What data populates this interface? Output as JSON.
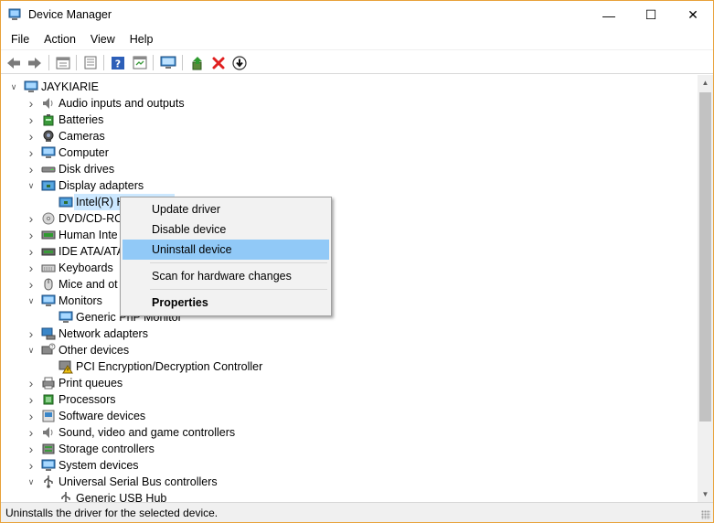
{
  "window": {
    "title": "Device Manager",
    "minimize_glyph": "—",
    "maximize_glyph": "☐",
    "close_glyph": "✕"
  },
  "menu": [
    "File",
    "Action",
    "View",
    "Help"
  ],
  "toolbar": [
    "back-icon",
    "forward-icon",
    "properties-icon",
    "show-hidden-icon",
    "help-icon",
    "action-view-icon",
    "monitor-icon",
    "update-driver-icon",
    "uninstall-icon",
    "download-icon"
  ],
  "tree": {
    "root": "JAYKIARIE",
    "items": [
      {
        "label": "Audio inputs and outputs",
        "icon": "speaker-icon",
        "level": 1,
        "state": "collapsed"
      },
      {
        "label": "Batteries",
        "icon": "battery-icon",
        "level": 1,
        "state": "collapsed"
      },
      {
        "label": "Cameras",
        "icon": "camera-icon",
        "level": 1,
        "state": "collapsed"
      },
      {
        "label": "Computer",
        "icon": "computer-icon",
        "level": 1,
        "state": "collapsed"
      },
      {
        "label": "Disk drives",
        "icon": "disk-icon",
        "level": 1,
        "state": "collapsed"
      },
      {
        "label": "Display adapters",
        "icon": "display-adapter-icon",
        "level": 1,
        "state": "expanded"
      },
      {
        "label": "Intel(R) H",
        "icon": "display-adapter-icon",
        "level": 2,
        "state": "leaf",
        "selected": true
      },
      {
        "label": "DVD/CD-RO",
        "icon": "dvd-icon",
        "level": 1,
        "state": "collapsed"
      },
      {
        "label": "Human Inte",
        "icon": "hid-icon",
        "level": 1,
        "state": "collapsed"
      },
      {
        "label": "IDE ATA/ATA",
        "icon": "ide-icon",
        "level": 1,
        "state": "collapsed"
      },
      {
        "label": "Keyboards",
        "icon": "keyboard-icon",
        "level": 1,
        "state": "collapsed"
      },
      {
        "label": "Mice and ot",
        "icon": "mouse-icon",
        "level": 1,
        "state": "collapsed"
      },
      {
        "label": "Monitors",
        "icon": "monitor-icon",
        "level": 1,
        "state": "expanded"
      },
      {
        "label": "Generic PnP Monitor",
        "icon": "monitor-icon",
        "level": 2,
        "state": "leaf"
      },
      {
        "label": "Network adapters",
        "icon": "network-icon",
        "level": 1,
        "state": "collapsed"
      },
      {
        "label": "Other devices",
        "icon": "other-device-icon",
        "level": 1,
        "state": "expanded"
      },
      {
        "label": "PCI Encryption/Decryption Controller",
        "icon": "warning-device-icon",
        "level": 2,
        "state": "leaf"
      },
      {
        "label": "Print queues",
        "icon": "printer-icon",
        "level": 1,
        "state": "collapsed"
      },
      {
        "label": "Processors",
        "icon": "processor-icon",
        "level": 1,
        "state": "collapsed"
      },
      {
        "label": "Software devices",
        "icon": "software-device-icon",
        "level": 1,
        "state": "collapsed"
      },
      {
        "label": "Sound, video and game controllers",
        "icon": "speaker-icon",
        "level": 1,
        "state": "collapsed"
      },
      {
        "label": "Storage controllers",
        "icon": "storage-icon",
        "level": 1,
        "state": "collapsed"
      },
      {
        "label": "System devices",
        "icon": "computer-icon",
        "level": 1,
        "state": "collapsed"
      },
      {
        "label": "Universal Serial Bus controllers",
        "icon": "usb-icon",
        "level": 1,
        "state": "expanded"
      },
      {
        "label": "Generic USB Hub",
        "icon": "usb-icon",
        "level": 2,
        "state": "leaf"
      }
    ]
  },
  "context_menu": {
    "items": [
      {
        "label": "Update driver",
        "name": "update-driver"
      },
      {
        "label": "Disable device",
        "name": "disable-device"
      },
      {
        "label": "Uninstall device",
        "name": "uninstall-device",
        "highlighted": true
      },
      {
        "label": "Scan for hardware changes",
        "name": "scan-hardware",
        "separator_before": true
      },
      {
        "label": "Properties",
        "name": "properties",
        "bold": true,
        "separator_before": true
      }
    ]
  },
  "status": {
    "text": "Uninstalls the driver for the selected device."
  },
  "colors": {
    "accent_border": "#e8a23a",
    "selection": "#cce8ff",
    "menu_highlight": "#91c9f7",
    "uninstall_red": "#e02020"
  }
}
